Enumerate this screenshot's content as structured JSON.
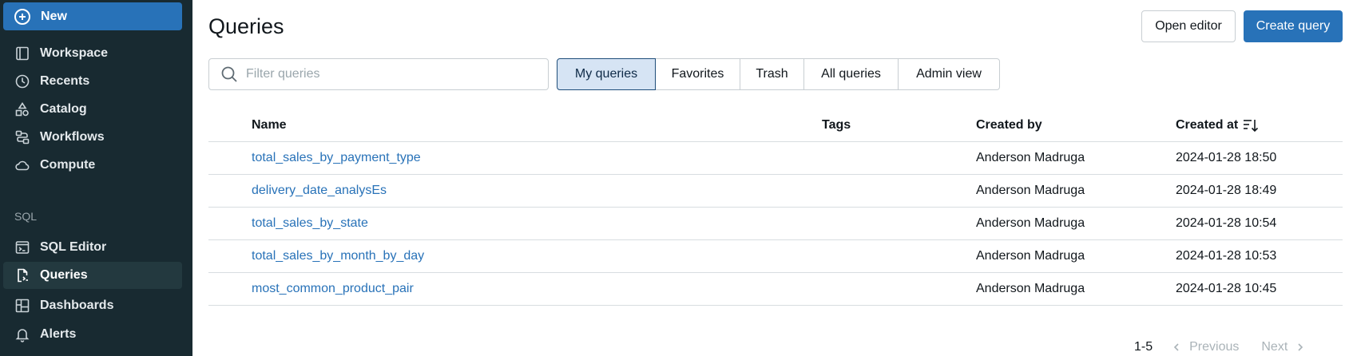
{
  "sidebar": {
    "new_label": "New",
    "items": [
      {
        "label": "Workspace",
        "icon": "workspace-icon"
      },
      {
        "label": "Recents",
        "icon": "clock-icon"
      },
      {
        "label": "Catalog",
        "icon": "catalog-icon"
      },
      {
        "label": "Workflows",
        "icon": "workflows-icon"
      },
      {
        "label": "Compute",
        "icon": "cloud-icon"
      }
    ],
    "sql_section_label": "SQL",
    "sql_items": [
      {
        "label": "SQL Editor",
        "icon": "sql-editor-icon"
      },
      {
        "label": "Queries",
        "icon": "queries-icon",
        "active": true
      },
      {
        "label": "Dashboards",
        "icon": "dashboards-icon"
      },
      {
        "label": "Alerts",
        "icon": "bell-icon"
      }
    ]
  },
  "header": {
    "title": "Queries",
    "open_editor_label": "Open editor",
    "create_query_label": "Create query"
  },
  "filter": {
    "placeholder": "Filter queries",
    "tabs": [
      "My queries",
      "Favorites",
      "Trash",
      "All queries",
      "Admin view"
    ],
    "active_tab": "My queries"
  },
  "table": {
    "columns": [
      "Name",
      "Tags",
      "Created by",
      "Created at"
    ],
    "sorted_column": "Created at",
    "rows": [
      {
        "name": "total_sales_by_payment_type",
        "tags": "",
        "created_by": "Anderson Madruga",
        "created_at": "2024-01-28 18:50"
      },
      {
        "name": "delivery_date_analysEs",
        "tags": "",
        "created_by": "Anderson Madruga",
        "created_at": "2024-01-28 18:49"
      },
      {
        "name": "total_sales_by_state",
        "tags": "",
        "created_by": "Anderson Madruga",
        "created_at": "2024-01-28 10:54"
      },
      {
        "name": "total_sales_by_month_by_day",
        "tags": "",
        "created_by": "Anderson Madruga",
        "created_at": "2024-01-28 10:53"
      },
      {
        "name": "most_common_product_pair",
        "tags": "",
        "created_by": "Anderson Madruga",
        "created_at": "2024-01-28 10:45"
      }
    ]
  },
  "pagination": {
    "range": "1-5",
    "previous_label": "Previous",
    "next_label": "Next"
  },
  "colors": {
    "sidebar_bg": "#182a31",
    "accent": "#2872b8",
    "link": "#2872b8",
    "active_tab_bg": "#d6e4f4"
  }
}
